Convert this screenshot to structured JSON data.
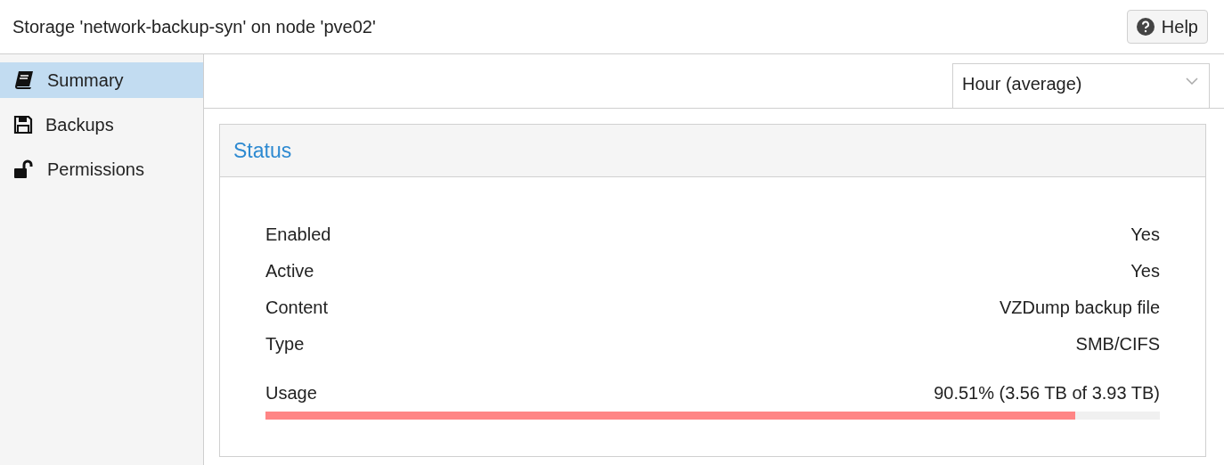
{
  "window": {
    "title": "Storage 'network-backup-syn' on node 'pve02'"
  },
  "help_button": {
    "label": "Help"
  },
  "sidebar": {
    "items": [
      {
        "label": "Summary",
        "kind": "book",
        "selected": true
      },
      {
        "label": "Backups",
        "kind": "floppy",
        "selected": false
      },
      {
        "label": "Permissions",
        "kind": "unlock",
        "selected": false
      }
    ]
  },
  "timeframe": {
    "value": "Hour (average)"
  },
  "status": {
    "title": "Status",
    "rows": [
      {
        "label": "Enabled",
        "value": "Yes"
      },
      {
        "label": "Active",
        "value": "Yes"
      },
      {
        "label": "Content",
        "value": "VZDump backup file"
      },
      {
        "label": "Type",
        "value": "SMB/CIFS"
      }
    ],
    "usage": {
      "label": "Usage",
      "reading": "90.51% (3.56 TB of 3.93 TB)",
      "level": 0.9051
    }
  }
}
